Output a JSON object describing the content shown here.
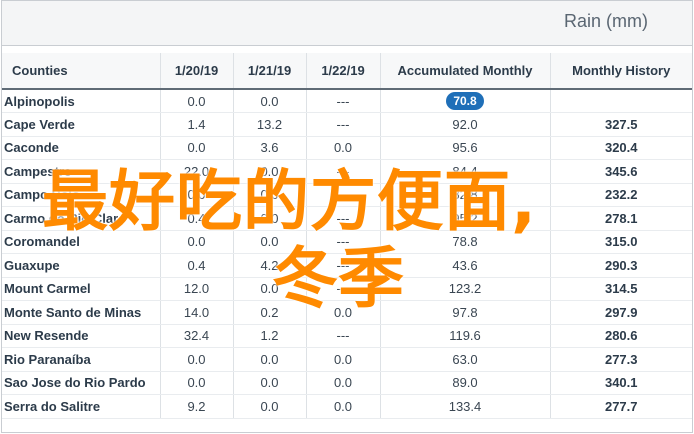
{
  "unit_label": "Rain (mm)",
  "columns": [
    "Counties",
    "1/20/19",
    "1/21/19",
    "1/22/19",
    "Accumulated Monthly",
    "Monthly History"
  ],
  "rows": [
    {
      "name": "Alpinopolis",
      "d1": "0.0",
      "d2": "0.0",
      "d3": "---",
      "acc": "70.8",
      "hist": "",
      "acc_highlight": true
    },
    {
      "name": "Cape Verde",
      "d1": "1.4",
      "d2": "13.2",
      "d3": "---",
      "acc": "92.0",
      "hist": "327.5"
    },
    {
      "name": "Caconde",
      "d1": "0.0",
      "d2": "3.6",
      "d3": "0.0",
      "acc": "95.6",
      "hist": "320.4"
    },
    {
      "name": "Campestre",
      "d1": "22.0",
      "d2": "0.0",
      "d3": "---",
      "acc": "84.4",
      "hist": "345.6"
    },
    {
      "name": "Campo Belo",
      "d1": "0.0",
      "d2": "0.0",
      "d3": "---",
      "acc": "82.8",
      "hist": "232.2"
    },
    {
      "name": "Carmo do Rio Claro",
      "d1": "0.4",
      "d2": "0.0",
      "d3": "---",
      "acc": "95.2",
      "hist": "278.1"
    },
    {
      "name": "Coromandel",
      "d1": "0.0",
      "d2": "0.0",
      "d3": "---",
      "acc": "78.8",
      "hist": "315.0"
    },
    {
      "name": "Guaxupe",
      "d1": "0.4",
      "d2": "4.2",
      "d3": "---",
      "acc": "43.6",
      "hist": "290.3"
    },
    {
      "name": "Mount Carmel",
      "d1": "12.0",
      "d2": "0.0",
      "d3": "---",
      "acc": "123.2",
      "hist": "314.5"
    },
    {
      "name": "Monte Santo de Minas",
      "d1": "14.0",
      "d2": "0.2",
      "d3": "0.0",
      "acc": "97.8",
      "hist": "297.9"
    },
    {
      "name": "New Resende",
      "d1": "32.4",
      "d2": "1.2",
      "d3": "---",
      "acc": "119.6",
      "hist": "280.6"
    },
    {
      "name": "Rio Paranaíba",
      "d1": "0.0",
      "d2": "0.0",
      "d3": "0.0",
      "acc": "63.0",
      "hist": "277.3"
    },
    {
      "name": "Sao Jose do Rio Pardo",
      "d1": "0.0",
      "d2": "0.0",
      "d3": "0.0",
      "acc": "89.0",
      "hist": "340.1"
    },
    {
      "name": "Serra do Salitre",
      "d1": "9.2",
      "d2": "0.0",
      "d3": "0.0",
      "acc": "133.4",
      "hist": "277.7"
    }
  ],
  "watermark": {
    "line1": "最好吃的方便面,",
    "line2": "冬季"
  }
}
